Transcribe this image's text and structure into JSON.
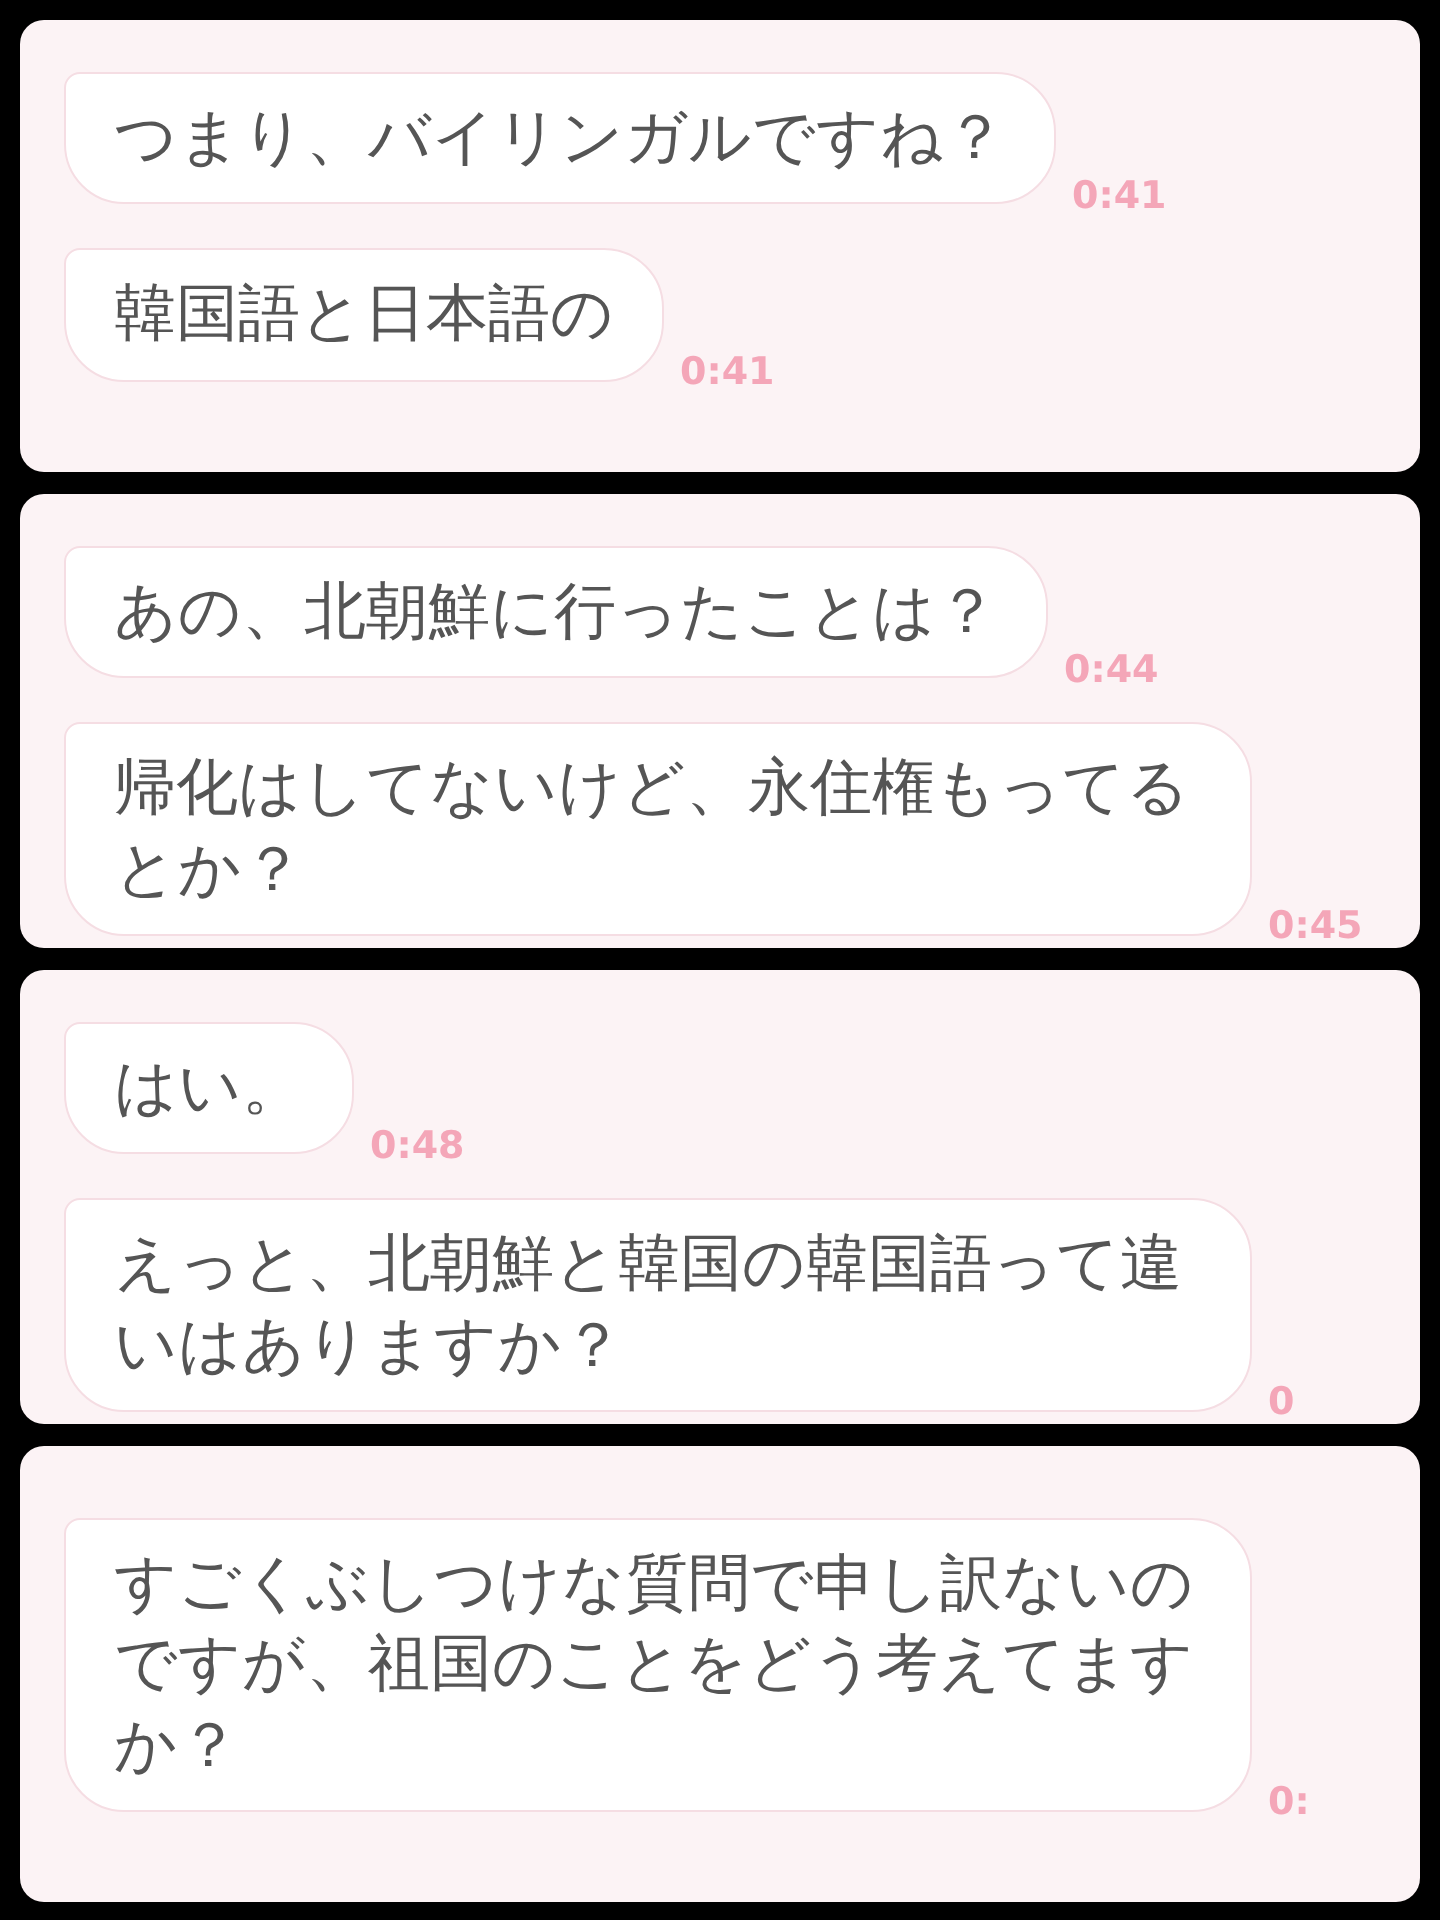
{
  "panels": [
    {
      "messages": [
        {
          "text": "つまり、バイリンガルですね？",
          "time": "0:41"
        },
        {
          "text": "韓国語と日本語の",
          "time": "0:41"
        }
      ]
    },
    {
      "messages": [
        {
          "text": "あの、北朝鮮に行ったことは？",
          "time": "0:44"
        },
        {
          "text": "帰化はしてないけど、永住権もってるとか？",
          "time": "0:45"
        }
      ]
    },
    {
      "messages": [
        {
          "text": "はい。",
          "time": "0:48"
        },
        {
          "text": "えっと、北朝鮮と韓国の韓国語って違いはありますか？",
          "time": "0"
        }
      ]
    },
    {
      "messages": [
        {
          "text": "すごくぶしつけな質問で申し訳ないのですが、祖国のことをどう考えてますか？",
          "time": "0:"
        }
      ]
    }
  ]
}
